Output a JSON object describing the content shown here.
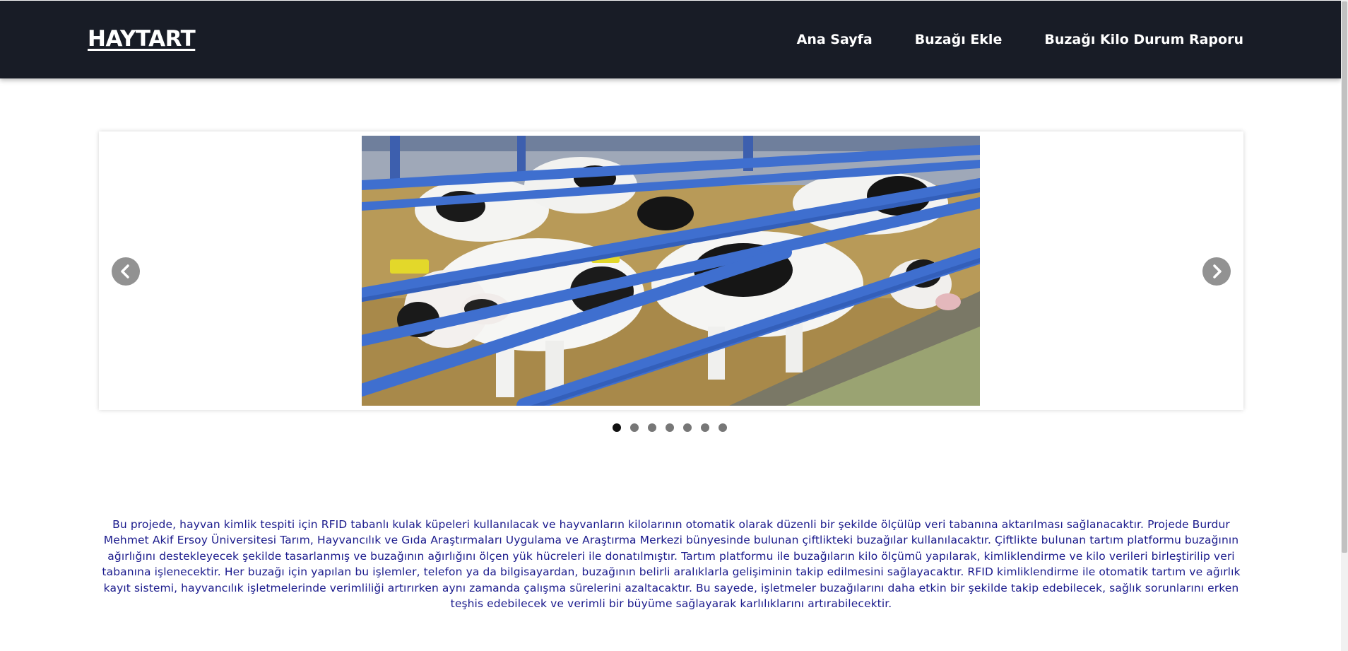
{
  "navbar": {
    "brand": "HAYTART",
    "links": [
      "Ana Sayfa",
      "Buzağı Ekle",
      "Buzağı Kilo Durum Raporu"
    ]
  },
  "carousel": {
    "image_subject": "calves behind blue barn rails",
    "prev_icon": "chevron-left-icon",
    "next_icon": "chevron-right-icon",
    "slide_count": 7,
    "active_slide": 1
  },
  "description": "Bu projede, hayvan kimlik tespiti için RFID tabanlı kulak küpeleri kullanılacak ve hayvanların kilolarının otomatik olarak düzenli bir şekilde ölçülüp veri tabanına aktarılması sağlanacaktır. Projede Burdur Mehmet Akif Ersoy Üniversitesi Tarım, Hayvancılık ve Gıda Araştırmaları Uygulama ve Araştırma Merkezi bünyesinde bulunan çiftlikteki buzağılar kullanılacaktır. Çiftlikte bulunan tartım platformu buzağının ağırlığını destekleyecek şekilde tasarlanmış ve buzağının ağırlığını ölçen yük hücreleri ile donatılmıştır. Tartım platformu ile buzağıların kilo ölçümü yapılarak, kimliklendirme ve kilo verileri birleştirilip veri tabanına işlenecektir. Her buzağı için yapılan bu işlemler, telefon ya da bilgisayardan, buzağının belirli aralıklarla gelişiminin takip edilmesini sağlayacaktır. RFID kimliklendirme ile otomatik tartım ve ağırlık kayıt sistemi, hayvancılık işletmelerinde verimliliği artırırken aynı zamanda çalışma sürelerini azaltacaktır. Bu sayede, işletmeler buzağılarını daha etkin bir şekilde takip edebilecek, sağlık sorunlarını erken teşhis edebilecek ve verimli bir büyüme sağlayarak karlılıklarını artırabilecektir.",
  "colors": {
    "navbar_bg": "#181c26",
    "text_blue": "#1a1a8c",
    "rail_blue": "#3f6fcf"
  }
}
